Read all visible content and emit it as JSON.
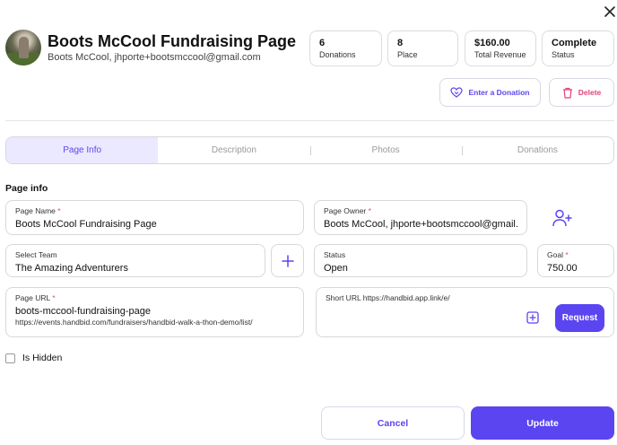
{
  "header": {
    "title": "Boots McCool Fundraising Page",
    "subtitle": "Boots McCool, jhporte+bootsmccool@gmail.com"
  },
  "stats": [
    {
      "value": "6",
      "label": "Donations"
    },
    {
      "value": "8",
      "label": "Place"
    },
    {
      "value": "$160.00",
      "label": "Total Revenue"
    },
    {
      "value": "Complete",
      "label": "Status"
    }
  ],
  "actions": {
    "enter_donation": "Enter a Donation",
    "delete": "Delete"
  },
  "tabs": [
    {
      "label": "Page Info"
    },
    {
      "label": "Description"
    },
    {
      "label": "Photos"
    },
    {
      "label": "Donations"
    }
  ],
  "section": {
    "title": "Page info"
  },
  "form": {
    "required_mark": "*",
    "page_name": {
      "label": "Page Name",
      "value": "Boots McCool Fundraising Page"
    },
    "page_owner": {
      "label": "Page Owner",
      "value": "Boots McCool, jhporte+bootsmccool@gmail.c"
    },
    "select_team": {
      "label": "Select Team",
      "value": "The Amazing Adventurers"
    },
    "status": {
      "label": "Status",
      "value": "Open"
    },
    "goal": {
      "label": "Goal",
      "value": "750.00"
    },
    "page_url": {
      "label": "Page URL",
      "value": "boots-mccool-fundraising-page",
      "full_url": "https://events.handbid.com/fundraisers/handbid-walk-a-thon-demo/list/"
    },
    "short_url": {
      "label": "Short URL https://handbid.app.link/e/"
    },
    "request": "Request",
    "is_hidden": "Is Hidden"
  },
  "footer": {
    "cancel": "Cancel",
    "update": "Update"
  },
  "colors": {
    "accent": "#5b45f0",
    "danger": "#e0447a",
    "tab_active_bg": "#ebe9ff"
  }
}
